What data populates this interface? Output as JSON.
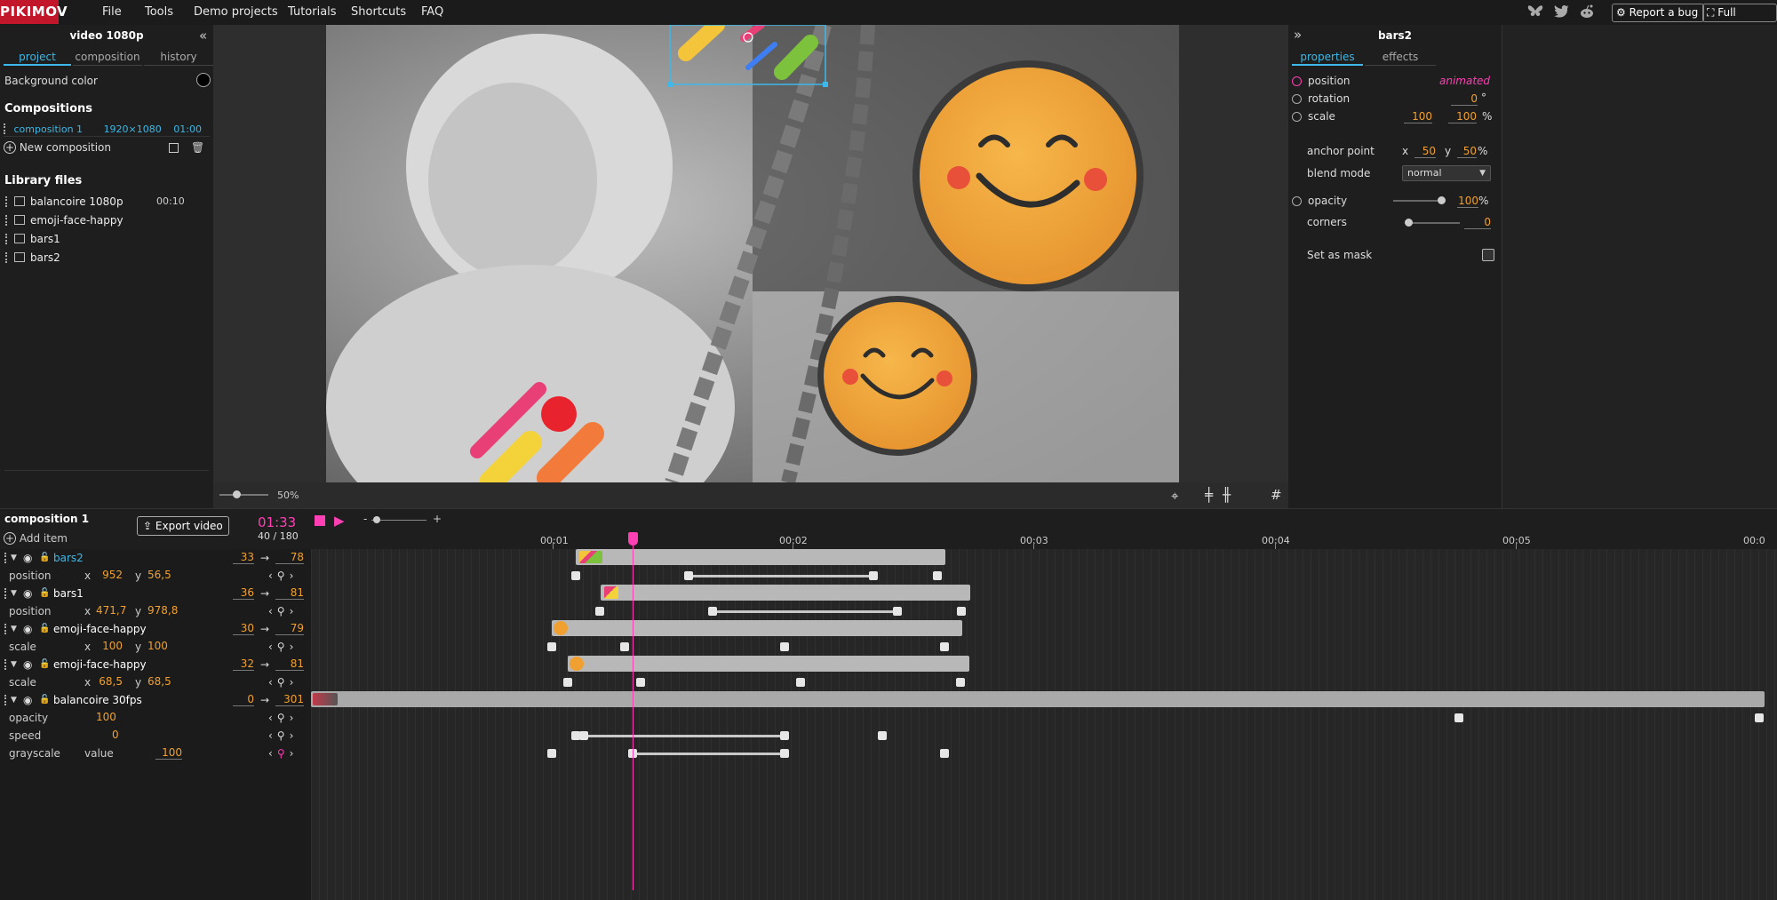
{
  "brand": {
    "logo_text": "PIKIMOV",
    "accent": "#c2172a",
    "highlight": "#ff3fb4",
    "link": "#3db8e8",
    "value_color": "#f0a030"
  },
  "menu": [
    "File",
    "Tools",
    "Demo projects",
    "Tutorials",
    "Shortcuts",
    "FAQ"
  ],
  "top_right": {
    "social_icons": [
      "butterfly-icon",
      "twitter-icon",
      "reddit-icon"
    ],
    "report_bug": "Report a bug",
    "full_screen": "Full screen"
  },
  "left_panel": {
    "title": "video 1080p",
    "tabs": [
      "project",
      "composition",
      "history"
    ],
    "background_label": "Background color",
    "compositions_title": "Compositions",
    "composition": {
      "name": "composition 1",
      "size": "1920×1080",
      "duration": "01:00"
    },
    "new_composition": "New composition",
    "library_title": "Library files",
    "library": [
      {
        "name": "balancoire 1080p",
        "duration": "00:10",
        "icon": "video-icon"
      },
      {
        "name": "emoji-face-happy",
        "duration": "",
        "icon": "image-icon"
      },
      {
        "name": "bars1",
        "duration": "",
        "icon": "image-icon"
      },
      {
        "name": "bars2",
        "duration": "",
        "icon": "image-icon"
      }
    ]
  },
  "preview": {
    "zoom": "50%"
  },
  "right_panel": {
    "title": "bars2",
    "tabs": [
      "properties",
      "effects"
    ],
    "position": {
      "label": "position",
      "value": "animated"
    },
    "rotation": {
      "label": "rotation",
      "value": "0",
      "unit": "°"
    },
    "scale": {
      "label": "scale",
      "x": "100",
      "y": "100",
      "unit": "%"
    },
    "anchor": {
      "label": "anchor point",
      "x_label": "x",
      "x": "50",
      "y_label": "y",
      "y": "50",
      "unit": "%"
    },
    "blend": {
      "label": "blend mode",
      "value": "normal"
    },
    "opacity": {
      "label": "opacity",
      "value": "100",
      "unit": "%",
      "level": 1.0
    },
    "corners": {
      "label": "corners",
      "value": "0",
      "level": 0.0
    },
    "mask": {
      "label": "Set as mask"
    }
  },
  "timeline": {
    "composition_name": "composition 1",
    "add_item": "Add item",
    "export": "Export video",
    "time": "01:33",
    "frame": "40 / 180",
    "zoom_minus": "-",
    "zoom_plus": "+",
    "ruler": [
      "00:01",
      "00:02",
      "00:03",
      "00:04",
      "00:05",
      "00:0"
    ],
    "layers": [
      {
        "name": "bars2",
        "in": "33",
        "out": "78",
        "selected": true,
        "prop": {
          "name": "position",
          "x_label": "x",
          "x": "952",
          "y_label": "y",
          "y": "56,5"
        }
      },
      {
        "name": "bars1",
        "in": "36",
        "out": "81",
        "selected": false,
        "prop": {
          "name": "position",
          "x_label": "x",
          "x": "471,7",
          "y_label": "y",
          "y": "978,8"
        }
      },
      {
        "name": "emoji-face-happy",
        "in": "30",
        "out": "79",
        "selected": false,
        "prop": {
          "name": "scale",
          "x_label": "x",
          "x": "100",
          "y_label": "y",
          "y": "100"
        }
      },
      {
        "name": "emoji-face-happy",
        "in": "32",
        "out": "81",
        "selected": false,
        "prop": {
          "name": "scale",
          "x_label": "x",
          "x": "68,5",
          "y_label": "y",
          "y": "68,5"
        }
      },
      {
        "name": "balancoire 30fps",
        "in": "0",
        "out": "301",
        "selected": false,
        "props": [
          {
            "name": "opacity",
            "value": "100"
          },
          {
            "name": "speed",
            "value": "0"
          },
          {
            "name": "grayscale",
            "sub": "value",
            "value": "100"
          }
        ]
      }
    ],
    "arrow_glyph": "→"
  }
}
